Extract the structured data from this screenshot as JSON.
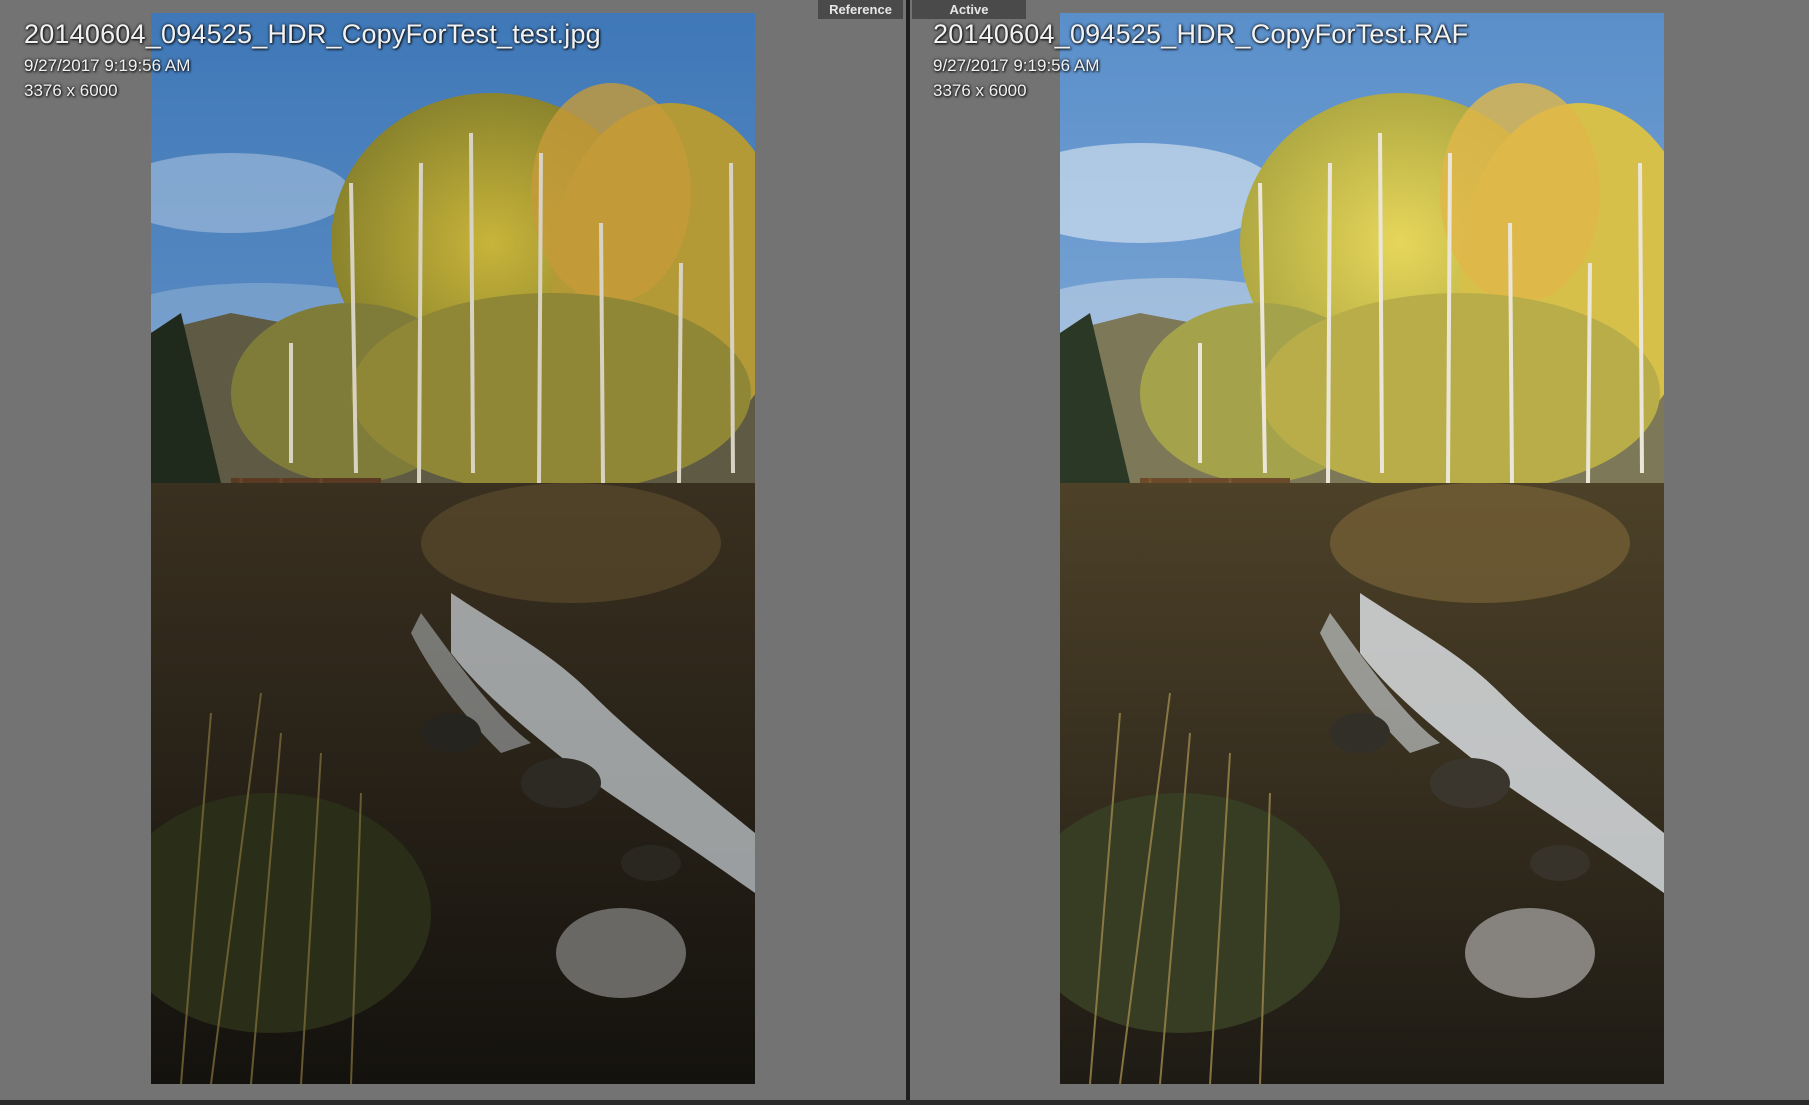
{
  "labels": {
    "reference": "Reference",
    "active": "Active"
  },
  "reference_photo": {
    "filename": "20140604_094525_HDR_CopyForTest_test.jpg",
    "datetime": "9/27/2017 9:19:56 AM",
    "dimensions": "3376 x 6000"
  },
  "active_photo": {
    "filename": "20140604_094525_HDR_CopyForTest.RAF",
    "datetime": "9/27/2017 9:19:56 AM",
    "dimensions": "3376 x 6000"
  },
  "colors": {
    "background": "#737373",
    "divider": "#1e1e1e",
    "tag_background": "#4a4a4a",
    "text": "#f2f2f2"
  }
}
